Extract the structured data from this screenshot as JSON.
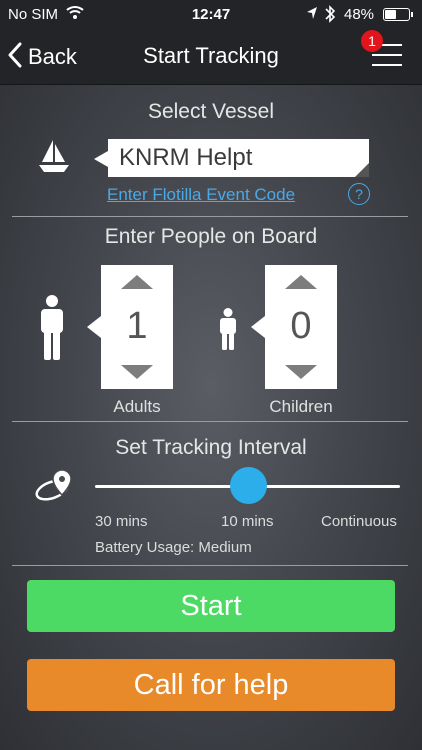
{
  "status_bar": {
    "carrier": "No SIM",
    "time": "12:47",
    "battery": "48%",
    "battery_level": 0.48
  },
  "nav": {
    "back_label": "Back",
    "title": "Start Tracking",
    "badge_count": "1"
  },
  "vessel": {
    "section_title": "Select Vessel",
    "selected": "KNRM Helpt",
    "flotilla_link": "Enter Flotilla Event Code",
    "help": "?"
  },
  "people": {
    "section_title": "Enter People on Board",
    "adults": {
      "value": "1",
      "label": "Adults"
    },
    "children": {
      "value": "0",
      "label": "Children"
    }
  },
  "interval": {
    "section_title": "Set Tracking Interval",
    "options": [
      "30 mins",
      "10 mins",
      "Continuous"
    ],
    "selected": "10 mins",
    "battery_usage": "Battery Usage: Medium"
  },
  "actions": {
    "start": "Start",
    "help": "Call for help"
  },
  "colors": {
    "start": "#4cd964",
    "help": "#e8892a",
    "accent": "#2baeea",
    "link": "#4aa9e8",
    "badge": "#e3151c"
  }
}
